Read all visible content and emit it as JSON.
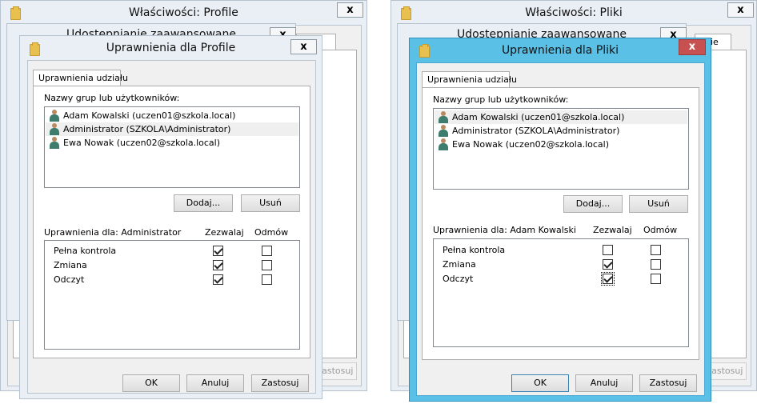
{
  "left": {
    "properties": {
      "title": "Właściwości: Profile",
      "close": "x",
      "tab_fragment": "nie",
      "apply": "Zastosuj"
    },
    "advanced": {
      "title": "Udostępnianie zaawansowane",
      "close": "x"
    },
    "permissions": {
      "title": "Uprawnienia dla Profile",
      "close": "x",
      "tab": "Uprawnienia udziału",
      "groups_label": "Nazwy grup lub użytkowników:",
      "users": [
        {
          "name": "Adam Kowalski (uczen01@szkola.local)",
          "selected": false
        },
        {
          "name": "Administrator (SZKOLA\\Administrator)",
          "selected": true
        },
        {
          "name": "Ewa Nowak (uczen02@szkola.local)",
          "selected": false
        }
      ],
      "add": "Dodaj...",
      "remove": "Usuń",
      "perm_label": "Uprawnienia dla: Administrator",
      "allow": "Zezwalaj",
      "deny": "Odmów",
      "perms": [
        {
          "name": "Pełna kontrola",
          "allow": true,
          "deny": false
        },
        {
          "name": "Zmiana",
          "allow": true,
          "deny": false
        },
        {
          "name": "Odczyt",
          "allow": true,
          "deny": false
        }
      ],
      "ok": "OK",
      "cancel": "Anuluj",
      "apply": "Zastosuj"
    }
  },
  "right": {
    "properties": {
      "title": "Właściwości: Pliki",
      "close": "x",
      "tab_fragment": "nie",
      "apply": "Zastosuj"
    },
    "advanced": {
      "title": "Udostępnianie zaawansowane",
      "close": "x"
    },
    "permissions": {
      "title": "Uprawnienia dla Pliki",
      "close": "x",
      "tab": "Uprawnienia udziału",
      "groups_label": "Nazwy grup lub użytkowników:",
      "users": [
        {
          "name": "Adam Kowalski (uczen01@szkola.local)",
          "selected": true
        },
        {
          "name": "Administrator (SZKOLA\\Administrator)",
          "selected": false
        },
        {
          "name": "Ewa Nowak (uczen02@szkola.local)",
          "selected": false
        }
      ],
      "add": "Dodaj...",
      "remove": "Usuń",
      "perm_label": "Uprawnienia dla: Adam Kowalski",
      "allow": "Zezwalaj",
      "deny": "Odmów",
      "perms": [
        {
          "name": "Pełna kontrola",
          "allow": false,
          "deny": false
        },
        {
          "name": "Zmiana",
          "allow": true,
          "deny": false
        },
        {
          "name": "Odczyt",
          "allow": true,
          "deny": false
        }
      ],
      "ok": "OK",
      "cancel": "Anuluj",
      "apply": "Zastosuj"
    }
  }
}
